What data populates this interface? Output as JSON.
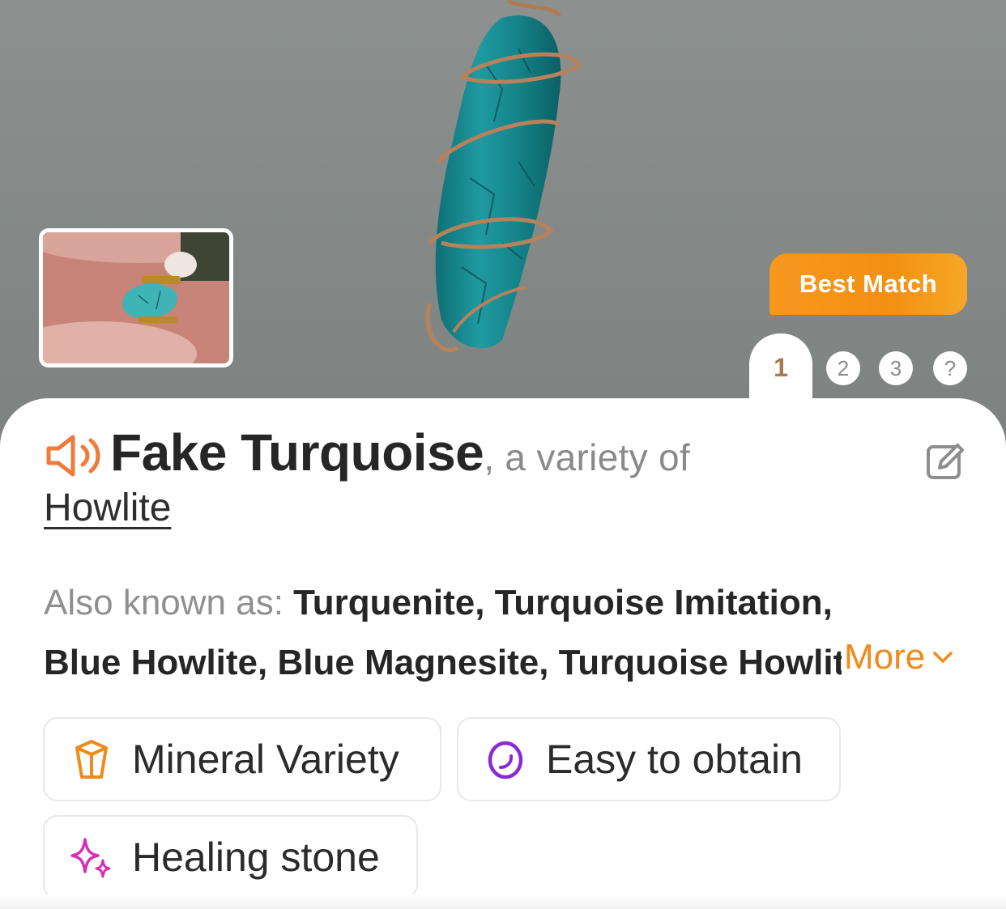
{
  "result": {
    "badge": "Best Match",
    "pages": [
      "1",
      "2",
      "3",
      "?"
    ],
    "current_page": "1",
    "name": "Fake Turquoise",
    "variety_prefix": ", a variety of",
    "parent": "Howlite",
    "aka_label": "Also known as: ",
    "aka_line1": "Turquenite, Turquoise Imitation,",
    "aka_line2": "Blue Howlite, Blue Magnesite, Turquoise Howlite",
    "more_label": "More",
    "chips": [
      {
        "label": "Mineral Variety",
        "icon": "crystal-icon"
      },
      {
        "label": "Easy to obtain",
        "icon": "ring-icon"
      },
      {
        "label": "Healing stone",
        "icon": "sparkle-icon"
      }
    ]
  },
  "colors": {
    "accent": "#f29012",
    "stone": "#1d8f94",
    "wire": "#a8774f",
    "chip_purple": "#8a2ad6",
    "chip_magenta": "#d62fb8"
  }
}
